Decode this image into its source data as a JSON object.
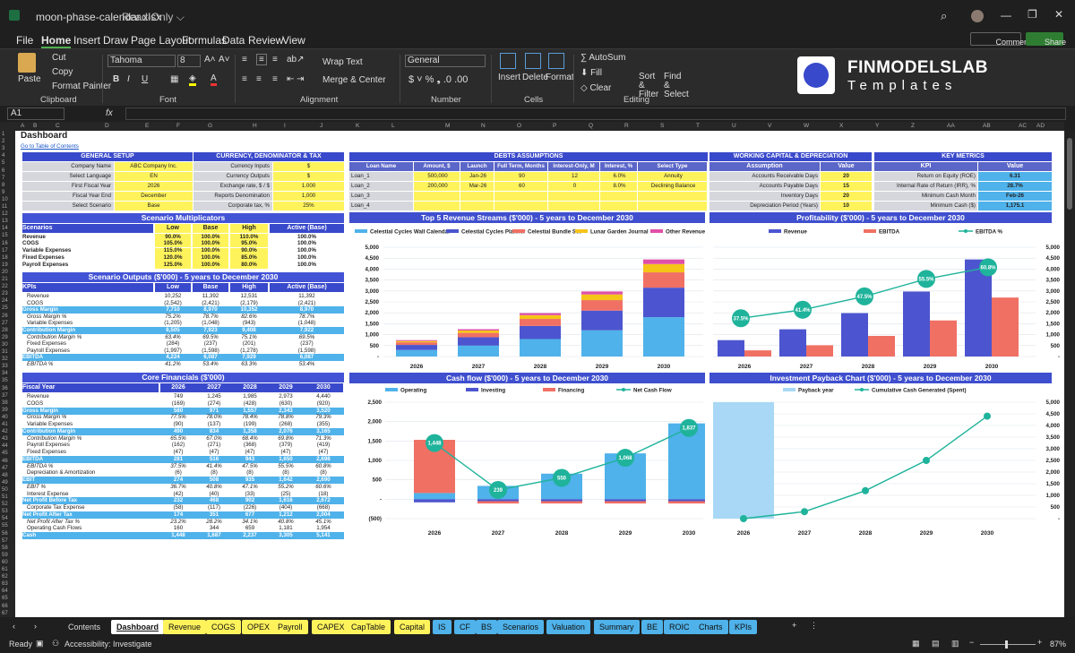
{
  "window": {
    "filename": "moon-phase-calendar.xlsx",
    "readonly": "Read-Only ⌵"
  },
  "menu": [
    "File",
    "Home",
    "Insert",
    "Draw",
    "Page Layout",
    "Formulas",
    "Data",
    "Review",
    "View"
  ],
  "top_buttons": {
    "comments": "Comments",
    "share": "Share"
  },
  "ribbon": {
    "paste": "Paste",
    "cut": "Cut",
    "copy": "Copy",
    "format_painter": "Format Painter",
    "clipboard": "Clipboard",
    "font_name": "Tahoma",
    "font_size": "8",
    "font": "Font",
    "wrap": "Wrap Text",
    "merge": "Merge & Center",
    "alignment": "Alignment",
    "number_format": "General",
    "number": "Number",
    "insert": "Insert",
    "delete": "Delete",
    "format": "Format",
    "cells": "Cells",
    "autosum": "AutoSum",
    "fill": "Fill",
    "clear": "Clear",
    "sort": "Sort & Filter",
    "find": "Find & Select",
    "editing": "Editing",
    "brand1": "FINMODELSLAB",
    "brand2": "Templates"
  },
  "formula": {
    "namebox": "A1",
    "fx": "fx"
  },
  "columns": [
    "A",
    "B",
    "C",
    "D",
    "E",
    "F",
    "G",
    "H",
    "I",
    "J",
    "K",
    "L",
    "M",
    "N",
    "O",
    "P",
    "Q",
    "R",
    "S",
    "T",
    "U",
    "V",
    "W",
    "X",
    "Y",
    "Z",
    "AA",
    "AB",
    "AC",
    "AD"
  ],
  "sheet": {
    "title": "Dashboard",
    "link": "Go to Table of Contents"
  },
  "general": {
    "title": "GENERAL SETUP",
    "rows": [
      [
        "Company Name",
        "ABC Company Inc."
      ],
      [
        "Select Language",
        "EN"
      ],
      [
        "First Fiscal Year",
        "2026"
      ],
      [
        "Fiscal Year End",
        "December"
      ],
      [
        "Select Scenario",
        "Base"
      ]
    ]
  },
  "currency": {
    "title": "CURRENCY, DENOMINATOR & TAX",
    "rows": [
      [
        "Currency Inputs",
        "$"
      ],
      [
        "Currency Outputs",
        "$"
      ],
      [
        "Exchange rate, $ / $",
        "1.000"
      ],
      [
        "Reports Denomination",
        "1,000"
      ],
      [
        "Corporate tax, %",
        "25%"
      ]
    ]
  },
  "debts": {
    "title": "DEBTS ASSUMPTIONS",
    "headers": [
      "Loan Name",
      "Amount, $",
      "Launch",
      "Full Term, Months",
      "Interest-Only, M",
      "Interest, %",
      "Select Type"
    ],
    "rows": [
      [
        "Loan_1",
        "500,000",
        "Jan-26",
        "90",
        "12",
        "6.0%",
        "Annuity"
      ],
      [
        "Loan_2",
        "200,000",
        "Mar-26",
        "60",
        "0",
        "8.0%",
        "Declining Balance"
      ],
      [
        "Loan_3",
        "",
        "",
        "",
        "",
        "",
        ""
      ],
      [
        "Loan_4",
        "",
        "",
        "",
        "",
        "",
        ""
      ]
    ]
  },
  "wc": {
    "title": "WORKING CAPITAL & DEPRECIATION",
    "headers": [
      "Assumption",
      "Value"
    ],
    "rows": [
      [
        "Accounts Receivable Days",
        "20"
      ],
      [
        "Accounts Payable Days",
        "15"
      ],
      [
        "Inventory Days",
        "20"
      ],
      [
        "Depreciation Period (Years)",
        "10"
      ]
    ]
  },
  "kpi": {
    "title": "KEY METRICS",
    "headers": [
      "KPI",
      "Value"
    ],
    "rows": [
      [
        "Return on Equity (ROE)",
        "6.31"
      ],
      [
        "Internal Rate of Return (IRR), %",
        "28.7%"
      ],
      [
        "Minimum Cash Month",
        "Feb-26"
      ],
      [
        "Minimum Cash ($)",
        "1,175.1"
      ]
    ]
  },
  "scen": {
    "title": "Scenario Multiplicators",
    "headers": [
      "Scenarios",
      "Low",
      "Base",
      "High",
      "Active (Base)"
    ],
    "rows": [
      [
        "Revenue",
        "90.0%",
        "100.0%",
        "110.0%",
        "100.0%"
      ],
      [
        "COGS",
        "105.0%",
        "100.0%",
        "95.0%",
        "100.0%"
      ],
      [
        "Variable Expenses",
        "115.0%",
        "100.0%",
        "90.0%",
        "100.0%"
      ],
      [
        "Fixed Expenses",
        "120.0%",
        "100.0%",
        "85.0%",
        "100.0%"
      ],
      [
        "Payroll Expenses",
        "125.0%",
        "100.0%",
        "80.0%",
        "100.0%"
      ]
    ]
  },
  "outputs": {
    "title": "Scenario Outputs ($'000) - 5 years to December 2030",
    "headers": [
      "KPIs",
      "Low",
      "Base",
      "High",
      "Active (Base)"
    ],
    "rows": [
      [
        "Revenue",
        "10,252",
        "11,392",
        "12,531",
        "11,392",
        "n"
      ],
      [
        "COGS",
        "(2,542)",
        "(2,421)",
        "(2,179)",
        "(2,421)",
        "n"
      ],
      [
        "Gross Margin",
        "7,710",
        "8,970",
        "10,352",
        "8,970",
        "b"
      ],
      [
        "Gross Margin %",
        "75.2%",
        "78.7%",
        "82.6%",
        "78.7%",
        "i"
      ],
      [
        "Variable Expenses",
        "(1,205)",
        "(1,048)",
        "(943)",
        "(1,048)",
        "n"
      ],
      [
        "Contribution Margin",
        "6,505",
        "7,923",
        "9,408",
        "7,922",
        "b"
      ],
      [
        "Contribution Margin %",
        "63.4%",
        "69.5%",
        "75.1%",
        "69.5%",
        "i"
      ],
      [
        "Fixed Expenses",
        "(284)",
        "(237)",
        "(201)",
        "(237)",
        "n"
      ],
      [
        "Payroll Expenses",
        "(1,997)",
        "(1,598)",
        "(1,278)",
        "(1,598)",
        "n"
      ],
      [
        "EBITDA",
        "4,224",
        "6,087",
        "7,929",
        "6,087",
        "b"
      ],
      [
        "EBITDA %",
        "41.2%",
        "53.4%",
        "63.3%",
        "53.4%",
        "i"
      ]
    ]
  },
  "core": {
    "title": "Core Financials ($'000)",
    "headers": [
      "Fiscal Year",
      "2026",
      "2027",
      "2028",
      "2029",
      "2030"
    ],
    "rows": [
      [
        "Revenue",
        "749",
        "1,245",
        "1,985",
        "2,973",
        "4,440",
        "n"
      ],
      [
        "COGS",
        "(169)",
        "(274)",
        "(428)",
        "(630)",
        "(920)",
        "n"
      ],
      [
        "Gross Margin",
        "580",
        "971",
        "1,557",
        "2,343",
        "3,520",
        "b"
      ],
      [
        "Gross Margin %",
        "77.5%",
        "78.0%",
        "78.4%",
        "78.8%",
        "79.3%",
        "i"
      ],
      [
        "Variable Expenses",
        "(90)",
        "(137)",
        "(199)",
        "(268)",
        "(355)",
        "n"
      ],
      [
        "Contribution Margin",
        "490",
        "834",
        "1,358",
        "2,076",
        "3,165",
        "b"
      ],
      [
        "Contribution Margin %",
        "65.5%",
        "67.0%",
        "68.4%",
        "69.8%",
        "71.3%",
        "i"
      ],
      [
        "Payroll Expenses",
        "(162)",
        "(271)",
        "(368)",
        "(379)",
        "(419)",
        "n"
      ],
      [
        "Fixed Expenses",
        "(47)",
        "(47)",
        "(47)",
        "(47)",
        "(47)",
        "n"
      ],
      [
        "EBITDA",
        "281",
        "516",
        "943",
        "1,650",
        "2,698",
        "b"
      ],
      [
        "EBITDA %",
        "37.5%",
        "41.4%",
        "47.5%",
        "55.5%",
        "60.8%",
        "i"
      ],
      [
        "Depreciation & Amortization",
        "(6)",
        "(8)",
        "(8)",
        "(8)",
        "(8)",
        "n"
      ],
      [
        "EBIT",
        "274",
        "508",
        "935",
        "1,642",
        "2,690",
        "b"
      ],
      [
        "EBIT %",
        "36.7%",
        "40.8%",
        "47.1%",
        "55.2%",
        "60.6%",
        "i"
      ],
      [
        "Interest Expense",
        "(42)",
        "(40)",
        "(33)",
        "(25)",
        "(18)",
        "n"
      ],
      [
        "Net Profit Before Tax",
        "232",
        "468",
        "902",
        "1,616",
        "2,672",
        "b"
      ],
      [
        "Corporate Tax Expense",
        "(58)",
        "(117)",
        "(226)",
        "(404)",
        "(668)",
        "n"
      ],
      [
        "Net Profit After Tax",
        "174",
        "351",
        "677",
        "1,212",
        "2,004",
        "b"
      ],
      [
        "Net Profit After Tax %",
        "23.2%",
        "28.2%",
        "34.1%",
        "40.8%",
        "45.1%",
        "i"
      ],
      [
        "Operating Cash Flows",
        "160",
        "344",
        "659",
        "1,181",
        "1,954",
        "n"
      ],
      [
        "Cash",
        "1,448",
        "1,687",
        "2,237",
        "3,305",
        "5,141",
        "b"
      ]
    ]
  },
  "charts": {
    "revenue": {
      "title": "Top 5 Revenue Streams ($'000) - 5 years to December 2030",
      "legend": [
        "Celestial Cycles Wall Calendar",
        "Celestial Cycles Planner",
        "Celestial Bundle Set",
        "Lunar Garden Journal",
        "Other Revenue"
      ],
      "colors": [
        "#4fb2ea",
        "#4c55cf",
        "#f07064",
        "#f5c518",
        "#e050a8"
      ],
      "years": [
        "2026",
        "2027",
        "2028",
        "2029",
        "2030"
      ],
      "series": [
        [
          300,
          500,
          800,
          1200,
          1800
        ],
        [
          230,
          380,
          600,
          900,
          1350
        ],
        [
          120,
          200,
          320,
          480,
          700
        ],
        [
          60,
          110,
          170,
          260,
          380
        ],
        [
          40,
          60,
          95,
          135,
          210
        ]
      ],
      "yticks": [
        "5,000",
        "4,500",
        "4,000",
        "3,500",
        "3,000",
        "2,500",
        "2,000",
        "1,500",
        "1,000",
        "500",
        "-"
      ],
      "ymax": 5000
    },
    "profit": {
      "title": "Profitability ($'000) - 5 years to December 2030",
      "legend": [
        "Revenue",
        "EBITDA",
        "EBITDA %"
      ],
      "years": [
        "2026",
        "2027",
        "2028",
        "2029",
        "2030"
      ],
      "revenue": [
        749,
        1245,
        1985,
        2973,
        4440
      ],
      "ebitda": [
        281,
        516,
        943,
        1650,
        2698
      ],
      "pct": [
        37.5,
        41.4,
        47.5,
        55.5,
        60.8
      ],
      "pct_labels": [
        "37.5%",
        "41.4%",
        "47.5%",
        "55.5%",
        "60.8%"
      ],
      "yticks": [
        "5,000",
        "4,500",
        "4,000",
        "3,500",
        "3,000",
        "2,500",
        "2,000",
        "1,500",
        "1,000",
        "500",
        "-"
      ],
      "ymax": 5000
    },
    "cash": {
      "title": "Cash flow ($'000) - 5 years to December 2030",
      "legend": [
        "Operating",
        "Investing",
        "Financing",
        "Net Cash Flow"
      ],
      "years": [
        "2026",
        "2027",
        "2028",
        "2029",
        "2030"
      ],
      "operating": [
        160,
        344,
        659,
        1181,
        1954
      ],
      "investing": [
        -80,
        -50,
        -50,
        -50,
        -50
      ],
      "financing": [
        1370,
        -60,
        -60,
        -60,
        -60
      ],
      "net": [
        1448,
        239,
        550,
        1068,
        1837
      ],
      "yticks": [
        "2,500",
        "2,000",
        "1,500",
        "1,000",
        "500",
        "-",
        "(500)"
      ],
      "ymin": -500,
      "ymax": 2500
    },
    "payback": {
      "title": "Investment Payback Chart ($'000) - 5 years to December 2030",
      "legend": [
        "Payback year",
        "Cumulative Cash Generated (Spent)"
      ],
      "years": [
        "2026",
        "2027",
        "2028",
        "2029",
        "2030"
      ],
      "cum": [
        0,
        300,
        1200,
        2500,
        4400
      ],
      "yticks": [
        "5,000",
        "4,500",
        "4,000",
        "3,500",
        "3,000",
        "2,500",
        "2,000",
        "1,500",
        "1,000",
        "500",
        "-"
      ],
      "ymax": 5000
    }
  },
  "tabs": [
    {
      "l": "Contents",
      "c": "#1f1f1f",
      "t": "#ddd"
    },
    {
      "l": "Dashboard",
      "c": "#fff",
      "t": "#111"
    },
    {
      "l": "Revenue",
      "c": "#fff35c",
      "t": "#111"
    },
    {
      "l": "COGS",
      "c": "#fff35c",
      "t": "#111"
    },
    {
      "l": "OPEX",
      "c": "#fff35c",
      "t": "#111"
    },
    {
      "l": "Payroll",
      "c": "#fff35c",
      "t": "#111"
    },
    {
      "l": "CAPEX",
      "c": "#fff35c",
      "t": "#111"
    },
    {
      "l": "CapTable",
      "c": "#fff35c",
      "t": "#111"
    },
    {
      "l": "Capital",
      "c": "#fff35c",
      "t": "#111"
    },
    {
      "l": "IS",
      "c": "#4fb2ea",
      "t": "#111"
    },
    {
      "l": "CF",
      "c": "#4fb2ea",
      "t": "#111"
    },
    {
      "l": "BS",
      "c": "#4fb2ea",
      "t": "#111"
    },
    {
      "l": "Scenarios",
      "c": "#4fb2ea",
      "t": "#111"
    },
    {
      "l": "Valuation",
      "c": "#4fb2ea",
      "t": "#111"
    },
    {
      "l": "Summary",
      "c": "#4fb2ea",
      "t": "#111"
    },
    {
      "l": "BE",
      "c": "#4fb2ea",
      "t": "#111"
    },
    {
      "l": "ROIC",
      "c": "#4fb2ea",
      "t": "#111"
    },
    {
      "l": "Charts",
      "c": "#4fb2ea",
      "t": "#111"
    },
    {
      "l": "KPIs",
      "c": "#4fb2ea",
      "t": "#111"
    }
  ],
  "status": {
    "ready": "Ready",
    "access": "Accessibility: Investigate",
    "zoom": "87%"
  },
  "colors": {
    "header_blue": "#3949cb",
    "yellow": "#fff35c",
    "teal": "#1fb39b",
    "light_blue": "#4fb2ea"
  }
}
